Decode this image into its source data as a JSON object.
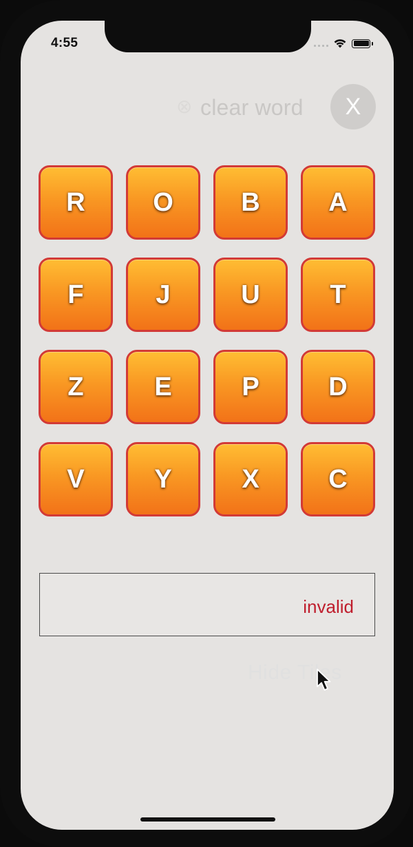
{
  "status_bar": {
    "time": "4:55",
    "icons": [
      "signal-icon",
      "wifi-icon",
      "battery-icon"
    ]
  },
  "header": {
    "clear_glyph": "⊗",
    "clear_label": "clear word",
    "clear_button_label": "X"
  },
  "board": {
    "tiles": [
      "R",
      "O",
      "B",
      "A",
      "F",
      "J",
      "U",
      "T",
      "Z",
      "E",
      "P",
      "D",
      "V",
      "Y",
      "X",
      "C"
    ]
  },
  "word_box": {
    "status": "invalid"
  },
  "footer": {
    "faint_label": "Hide Tiles"
  },
  "colors": {
    "background": "#e5e3e1",
    "tile_top": "#ffbd33",
    "tile_bottom": "#f27218",
    "tile_border": "#d23a36",
    "invalid": "#bf1e2d"
  }
}
